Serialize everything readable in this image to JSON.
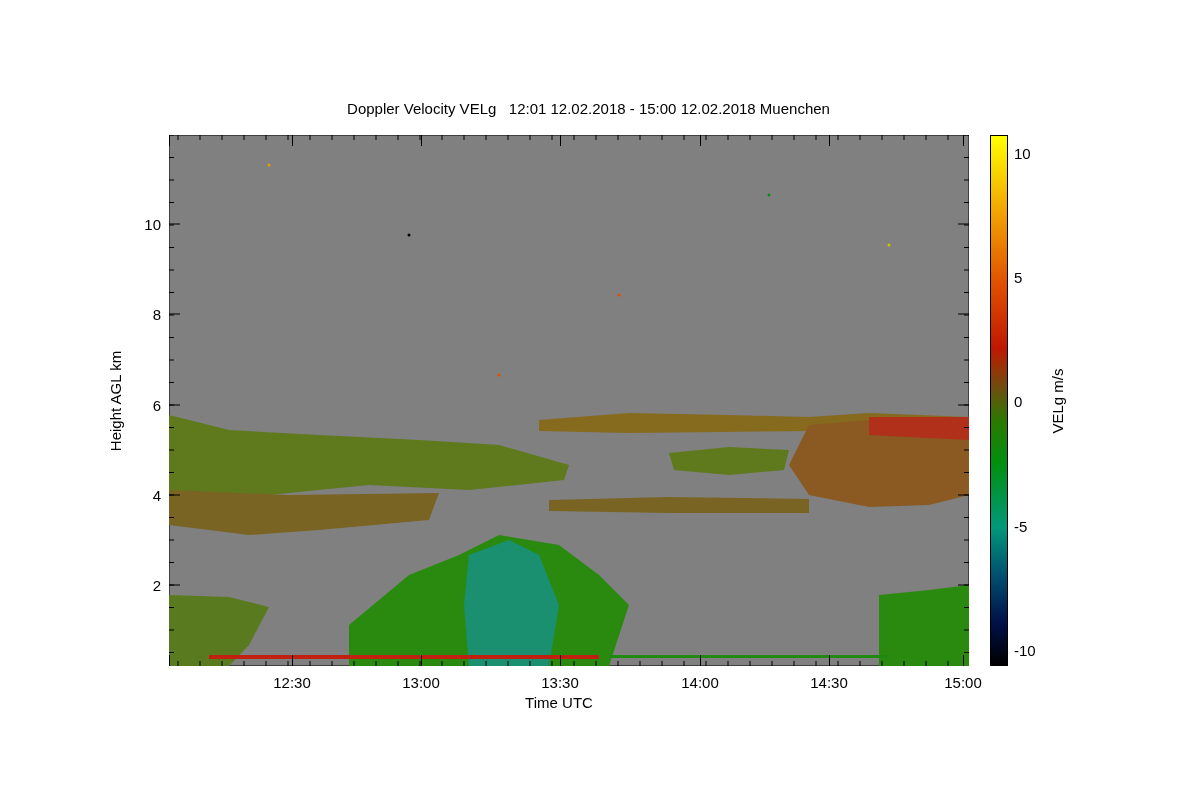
{
  "title": "Doppler Velocity VELg   12:01 12.02.2018 - 15:00 12.02.2018 Muenchen",
  "y_axis": {
    "label": "Height AGL km",
    "ticks": [
      "10",
      "8",
      "6",
      "4",
      "2"
    ]
  },
  "x_axis": {
    "label": "Time UTC",
    "ticks": [
      "12:30",
      "13:00",
      "13:30",
      "14:00",
      "14:30",
      "15:00"
    ]
  },
  "colorbar": {
    "label": "VELg m/s",
    "ticks": [
      "10",
      "5",
      "0",
      "-5",
      "-10"
    ]
  }
}
